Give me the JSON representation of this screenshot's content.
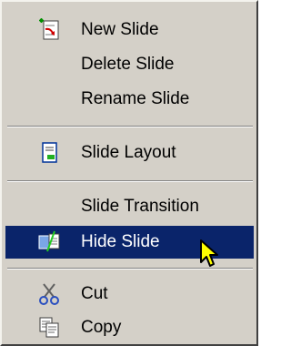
{
  "menu": {
    "items": [
      {
        "id": "new-slide",
        "label": "New Slide",
        "icon": "new-slide-icon"
      },
      {
        "id": "delete-slide",
        "label": "Delete Slide"
      },
      {
        "id": "rename-slide",
        "label": "Rename Slide"
      },
      {
        "id": "slide-layout",
        "label": "Slide Layout",
        "icon": "slide-layout-icon"
      },
      {
        "id": "slide-transition",
        "label": "Slide Transition"
      },
      {
        "id": "hide-slide",
        "label": "Hide Slide",
        "icon": "hide-slide-icon",
        "selected": true
      },
      {
        "id": "cut",
        "label": "Cut",
        "icon": "scissors-icon"
      },
      {
        "id": "copy",
        "label": "Copy",
        "icon": "copy-icon"
      }
    ],
    "colors": {
      "background": "#d4d0c8",
      "selection": "#0a246a",
      "selection_text": "#ffffff",
      "cursor": "#ffff00"
    }
  }
}
